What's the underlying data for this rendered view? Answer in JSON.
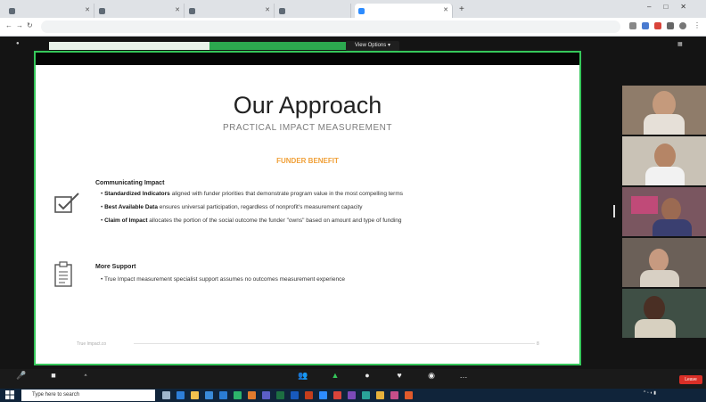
{
  "browser": {
    "tabs": [
      {
        "label": "",
        "color": "#5f6a75"
      },
      {
        "label": "",
        "color": "#5f6a75"
      },
      {
        "label": "",
        "color": "#5f6a75"
      },
      {
        "label": "",
        "color": "#5f6a75"
      },
      {
        "label": "",
        "color": "#2d8cff",
        "active": true
      }
    ],
    "url": ""
  },
  "zoom": {
    "view_options": "View Options ▾"
  },
  "slide": {
    "title": "Our Approach",
    "subtitle": "PRACTICAL IMPACT MEASUREMENT",
    "section": "FUNDER BENEFIT",
    "block1": {
      "heading": "Communicating Impact",
      "bullets": [
        {
          "bold": "Standardized Indicators",
          "text": " aligned with funder priorities that demonstrate program value in the most compelling terms"
        },
        {
          "bold": "Best Available Data",
          "text": " ensures universal participation, regardless of nonprofit's measurement capacity"
        },
        {
          "bold": "Claim of Impact",
          "text": " allocates the portion of the social outcome the funder \"owns\" based on amount and type of funding"
        }
      ]
    },
    "block2": {
      "heading": "More Support",
      "bullets": [
        {
          "bold": "",
          "text": "True Impact measurement specialist support assumes no outcomes measurement experience"
        }
      ]
    },
    "footer": "True Impact.co",
    "page": "8"
  },
  "participants": [
    {
      "id": "p1",
      "bg": "#8f7c6a"
    },
    {
      "id": "p2",
      "bg": "#c9c2b6"
    },
    {
      "id": "p3",
      "bg": "#7a5660"
    },
    {
      "id": "p4",
      "bg": "#6b6058"
    },
    {
      "id": "p5",
      "bg": "#3f4f45"
    }
  ],
  "toolbar": {
    "leave": "Leave"
  },
  "taskbar": {
    "search_placeholder": "Type here to search"
  },
  "colors": {
    "share_green": "#35c75a",
    "accent_orange": "#f0a038",
    "leave_red": "#d92f27"
  }
}
